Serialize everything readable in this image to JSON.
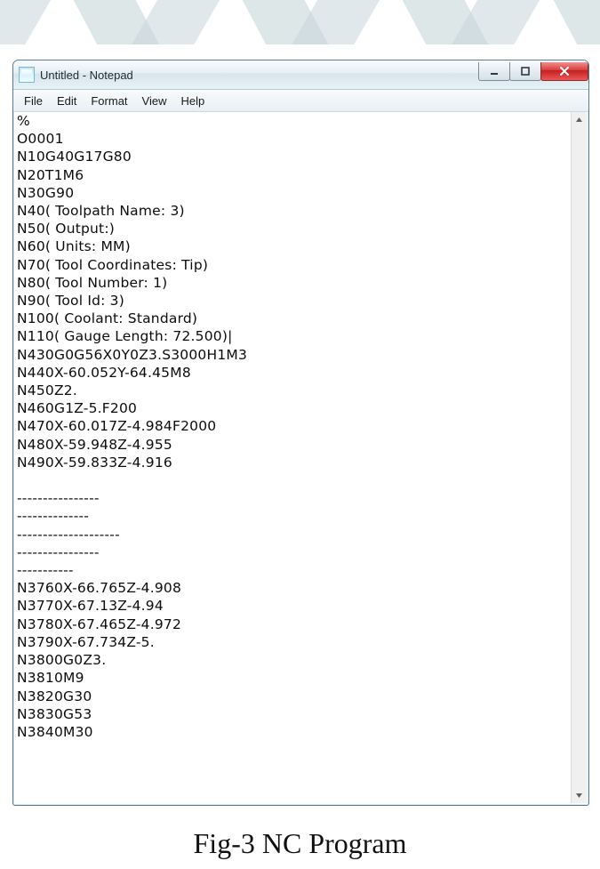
{
  "window": {
    "title": "Untitled - Notepad"
  },
  "menu": {
    "file": "File",
    "edit": "Edit",
    "format": "Format",
    "view": "View",
    "help": "Help"
  },
  "editor": {
    "content": "%\nO0001\nN10G40G17G80\nN20T1M6\nN30G90\nN40( Toolpath Name: 3)\nN50( Output:)\nN60( Units: MM)\nN70( Tool Coordinates: Tip)\nN80( Tool Number: 1)\nN90( Tool Id: 3)\nN100( Coolant: Standard)\nN110( Gauge Length: 72.500)|\nN430G0G56X0Y0Z3.S3000H1M3\nN440X-60.052Y-64.45M8\nN450Z2.\nN460G1Z-5.F200\nN470X-60.017Z-4.984F2000\nN480X-59.948Z-4.955\nN490X-59.833Z-4.916\n\n----------------\n--------------\n--------------------\n----------------\n-----------\nN3760X-66.765Z-4.908\nN3770X-67.13Z-4.94\nN3780X-67.465Z-4.972\nN3790X-67.734Z-5.\nN3800G0Z3.\nN3810M9\nN3820G30\nN3830G53\nN3840M30"
  },
  "caption": "Fig-3 NC Program"
}
